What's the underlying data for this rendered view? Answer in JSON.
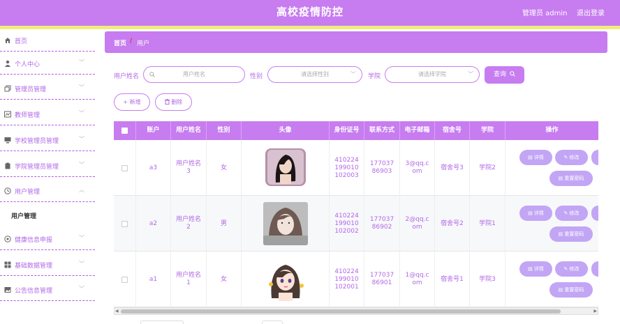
{
  "header": {
    "title": "高校疫情防控",
    "admin": "管理员 admin",
    "logout": "退出登录"
  },
  "sidebar": {
    "items": [
      {
        "label": "首页",
        "icon": "home-icon"
      },
      {
        "label": "个人中心",
        "icon": "user-icon"
      },
      {
        "label": "管理员管理",
        "icon": "copy-icon"
      },
      {
        "label": "教师管理",
        "icon": "chart-icon"
      },
      {
        "label": "学校管理员管理",
        "icon": "monitor-icon"
      },
      {
        "label": "学院管理员管理",
        "icon": "clipboard-icon"
      },
      {
        "label": "用户管理",
        "icon": "clock-icon"
      },
      {
        "label": "健康信息申报",
        "icon": "globe-icon"
      },
      {
        "label": "基础数据管理",
        "icon": "grid-icon"
      },
      {
        "label": "公告信息管理",
        "icon": "picture-icon"
      }
    ],
    "sub_item": "用户管理"
  },
  "breadcrumb": {
    "home": "首页",
    "sep": "/",
    "current": "用户"
  },
  "filters": {
    "name_label": "用户姓名",
    "name_placeholder": "用户姓名",
    "gender_label": "性别",
    "gender_placeholder": "请选择性别",
    "college_label": "学院",
    "college_placeholder": "请选择学院",
    "query": "查询"
  },
  "actions": {
    "add": "+ 新增",
    "delete": "删除"
  },
  "table": {
    "headers": [
      "账户",
      "用户姓名",
      "性别",
      "头像",
      "身份证号",
      "联系方式",
      "电子邮箱",
      "宿舍号",
      "学院",
      "操作"
    ],
    "rows": [
      {
        "account": "a3",
        "name": "用户姓名3",
        "gender": "女",
        "id": "410224199010102003",
        "phone": "17703786903",
        "email": "3@qq.com",
        "dorm": "宿舍号3",
        "college": "学院2"
      },
      {
        "account": "a2",
        "name": "用户姓名2",
        "gender": "男",
        "id": "410224199010102002",
        "phone": "17703786902",
        "email": "2@qq.com",
        "dorm": "宿舍号2",
        "college": "学院1"
      },
      {
        "account": "a1",
        "name": "用户姓名1",
        "gender": "女",
        "id": "410224199010102001",
        "phone": "17703786901",
        "email": "1@qq.com",
        "dorm": "宿舍号1",
        "college": "学院3"
      }
    ],
    "btn_detail": "详情",
    "btn_edit": "修改",
    "btn_reset": "重置密码"
  },
  "colors": {
    "accent": "#c77cf0",
    "text_accent": "#b168e6",
    "strip": "#f1ec7a"
  }
}
